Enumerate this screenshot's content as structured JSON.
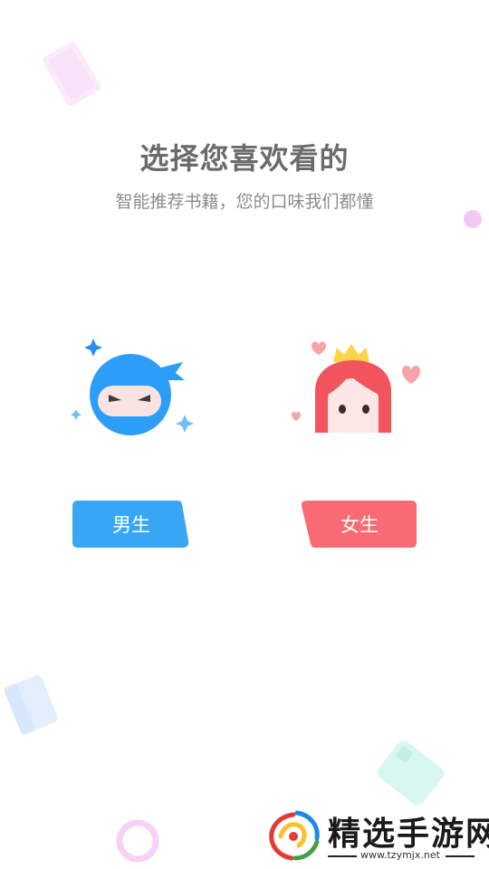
{
  "header": {
    "title": "选择您喜欢看的",
    "subtitle": "智能推荐书籍，您的口味我们都懂"
  },
  "options": {
    "male": {
      "label": "男生",
      "color": "#37a7f5",
      "icon": "ninja-avatar-icon"
    },
    "female": {
      "label": "女生",
      "color": "#f86b74",
      "icon": "princess-avatar-icon"
    }
  },
  "watermark": {
    "text": "精选手游网",
    "url": "www.tzymjx.net"
  },
  "colors": {
    "background": "#ffffff",
    "title": "#6b6b6b",
    "subtitle": "#8c8c8c"
  }
}
